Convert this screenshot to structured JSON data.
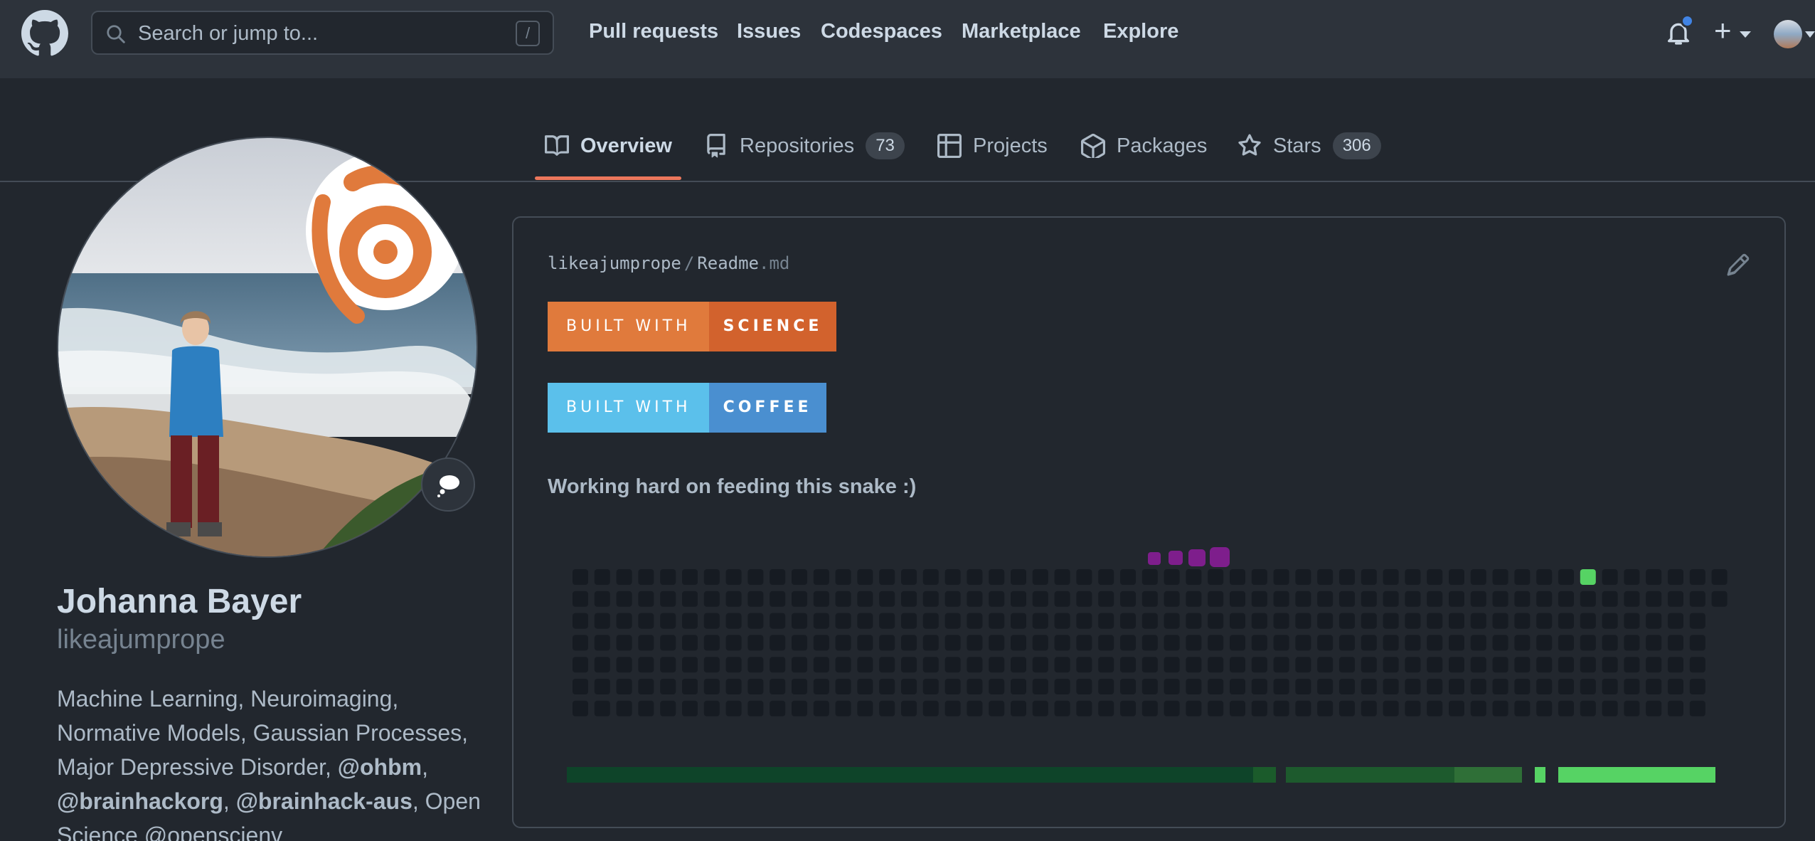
{
  "header": {
    "search_placeholder": "Search or jump to...",
    "search_shortcut": "/",
    "nav": [
      "Pull requests",
      "Issues",
      "Codespaces",
      "Marketplace",
      "Explore"
    ],
    "plus": "+"
  },
  "tabs": [
    {
      "label": "Overview",
      "icon": "book-icon",
      "selected": true
    },
    {
      "label": "Repositories",
      "icon": "repo-icon",
      "count": "73"
    },
    {
      "label": "Projects",
      "icon": "table-icon"
    },
    {
      "label": "Packages",
      "icon": "package-icon"
    },
    {
      "label": "Stars",
      "icon": "star-icon",
      "count": "306"
    }
  ],
  "profile": {
    "name": "Johanna Bayer",
    "login": "likeajumprope",
    "bio": {
      "text1": "Machine Learning, Neuroimaging, Normative Models, Gaussian Processes, Major Depressive Disorder, ",
      "mention1": "@ohbm",
      "sep1": ", ",
      "mention2": "@brainhackorg",
      "sep2": ", ",
      "mention3": "@brainhack-aus",
      "text2": ", Open Science @openscienv"
    }
  },
  "readme": {
    "owner": "likeajumprope",
    "sep": "/",
    "file": "Readme",
    "ext": ".md",
    "badges": [
      {
        "left": "BUILT WITH",
        "right": "SCIENCE",
        "left_color": "#e07a3c",
        "right_color": "#d2622d"
      },
      {
        "left": "BUILT WITH",
        "right": "COFFEE",
        "left_color": "#5bc0eb",
        "right_color": "#4a8fd0"
      }
    ],
    "snake_text": "Working hard on feeding this snake :)"
  },
  "colors": {
    "accent": "#ec775c",
    "cell_empty": "#161b22",
    "snake": "#7e1e8c",
    "contrib_green": "#56d364"
  }
}
